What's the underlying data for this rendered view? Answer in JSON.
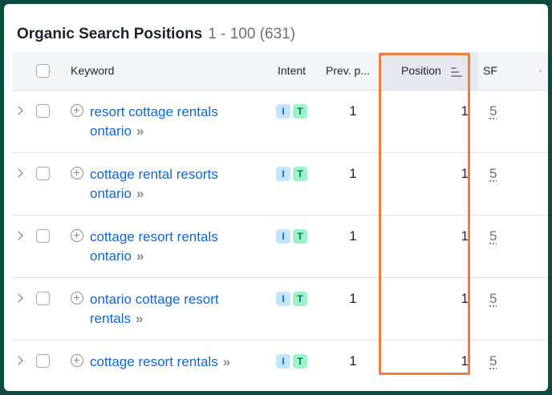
{
  "header": {
    "title": "Organic Search Positions",
    "range": "1 - 100 (631)"
  },
  "columns": {
    "keyword": "Keyword",
    "intent": "Intent",
    "prev": "Prev. p...",
    "position": "Position",
    "sf": "SF"
  },
  "rows": [
    {
      "kw_line1": "resort cottage rentals",
      "kw_line2": "ontario",
      "intent_i": "I",
      "intent_t": "T",
      "prev": "1",
      "position": "1",
      "sf": "5"
    },
    {
      "kw_line1": "cottage rental resorts",
      "kw_line2": "ontario",
      "intent_i": "I",
      "intent_t": "T",
      "prev": "1",
      "position": "1",
      "sf": "5"
    },
    {
      "kw_line1": "cottage resort rentals",
      "kw_line2": "ontario",
      "intent_i": "I",
      "intent_t": "T",
      "prev": "1",
      "position": "1",
      "sf": "5"
    },
    {
      "kw_line1": "ontario cottage resort",
      "kw_line2": "rentals",
      "intent_i": "I",
      "intent_t": "T",
      "prev": "1",
      "position": "1",
      "sf": "5"
    },
    {
      "kw_line1": "cottage resort rentals",
      "kw_line2": "",
      "intent_i": "I",
      "intent_t": "T",
      "prev": "1",
      "position": "1",
      "sf": "5"
    }
  ],
  "icons": {
    "expand": "chevron-right-icon",
    "add": "plus-circle-icon",
    "open": "double-chevron-right-icon",
    "sort": "sort-icon"
  },
  "colors": {
    "link": "#1466c8",
    "highlight": "#f07c45",
    "intent_i_bg": "#c4e5fe",
    "intent_t_bg": "#9ef2c9",
    "frame": "#0e4a40"
  },
  "chevron_glyph": "»"
}
